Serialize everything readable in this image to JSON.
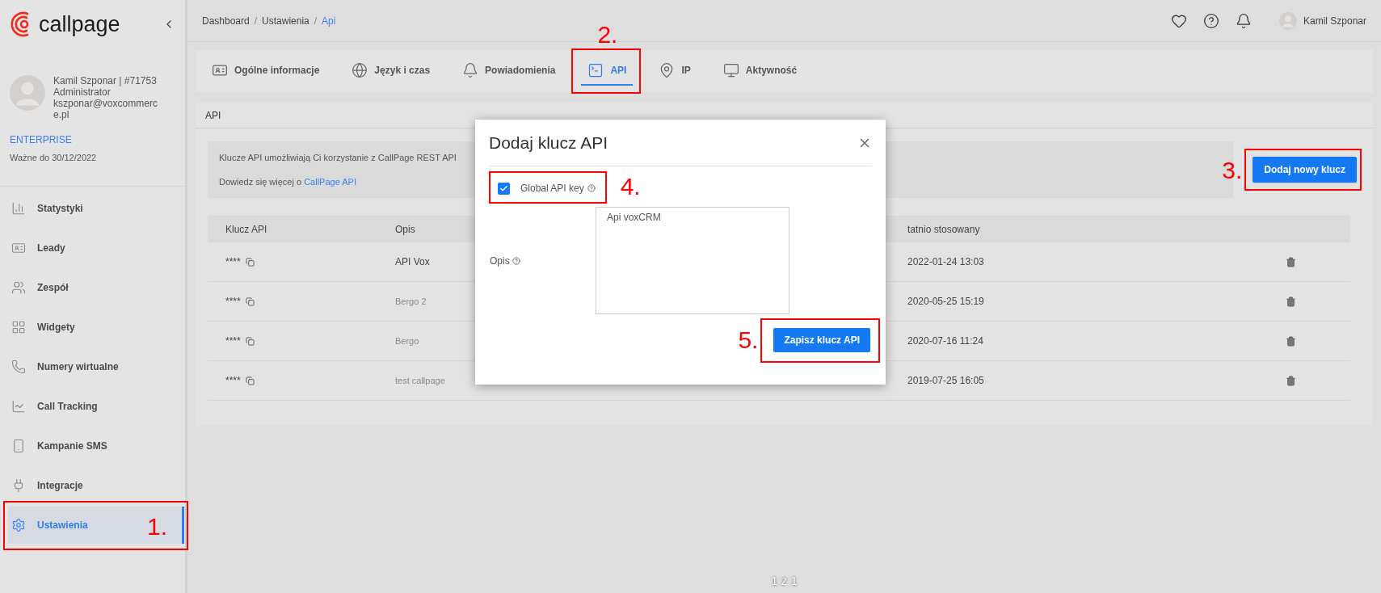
{
  "sidebar": {
    "logo": "callpage",
    "user": {
      "name": "Kamil Szponar | #71753",
      "role": "Administrator",
      "email": "kszponar@voxcommerce.pl"
    },
    "plan": "ENTERPRISE",
    "valid_until": "Ważne do 30/12/2022",
    "items": [
      {
        "label": "Statystyki",
        "selected": false
      },
      {
        "label": "Leady",
        "selected": false
      },
      {
        "label": "Zespół",
        "selected": false
      },
      {
        "label": "Widgety",
        "selected": false
      },
      {
        "label": "Numery wirtualne",
        "selected": false
      },
      {
        "label": "Call Tracking",
        "selected": false
      },
      {
        "label": "Kampanie SMS",
        "selected": false
      },
      {
        "label": "Integracje",
        "selected": false
      },
      {
        "label": "Ustawienia",
        "selected": true,
        "annotation": "1."
      }
    ]
  },
  "breadcrumb_separator": "/",
  "breadcrumb": [
    {
      "label": "Dashboard",
      "current": false
    },
    {
      "label": "Ustawienia",
      "current": false
    },
    {
      "label": "Api",
      "current": true
    }
  ],
  "header": {
    "user": "Kamil Szponar"
  },
  "tabs": [
    {
      "label": "Ogólne informacje",
      "selected": false
    },
    {
      "label": "Język i czas",
      "selected": false
    },
    {
      "label": "Powiadomienia",
      "selected": false
    },
    {
      "label": "API",
      "selected": true,
      "annotation": "2."
    },
    {
      "label": "IP",
      "selected": false
    },
    {
      "label": "Aktywność",
      "selected": false
    }
  ],
  "section_title": "API",
  "info": {
    "text": "Klucze API umożliwiają Ci korzystanie z CallPage REST API",
    "more": "Dowiedz się więcej o",
    "link": "CallPage API"
  },
  "add_button": {
    "label": "Dodaj nowy klucz",
    "annotation": "3."
  },
  "table": {
    "columns": [
      "Klucz API",
      "Opis",
      "tatnio stosowany"
    ],
    "rows": [
      {
        "key": "****",
        "description": "API Vox",
        "blurred": false,
        "last_used": "2022-01-24 13:03"
      },
      {
        "key": "****",
        "description": "Bergo 2",
        "blurred": true,
        "last_used": "2020-05-25 15:19"
      },
      {
        "key": "****",
        "description": "Bergo",
        "blurred": true,
        "last_used": "2020-07-16 11:24"
      },
      {
        "key": "****",
        "description": "test callpage",
        "blurred": true,
        "last_used": "2019-07-25 16:05"
      }
    ]
  },
  "modal": {
    "title": "Dodaj klucz API",
    "global_key": {
      "label": "Global API key",
      "checked": true,
      "annotation": "4."
    },
    "field_label": "Opis",
    "value": "Api voxCRM",
    "save_button": {
      "label": "Zapisz klucz API",
      "annotation": "5."
    }
  },
  "pager": "1 z 1"
}
